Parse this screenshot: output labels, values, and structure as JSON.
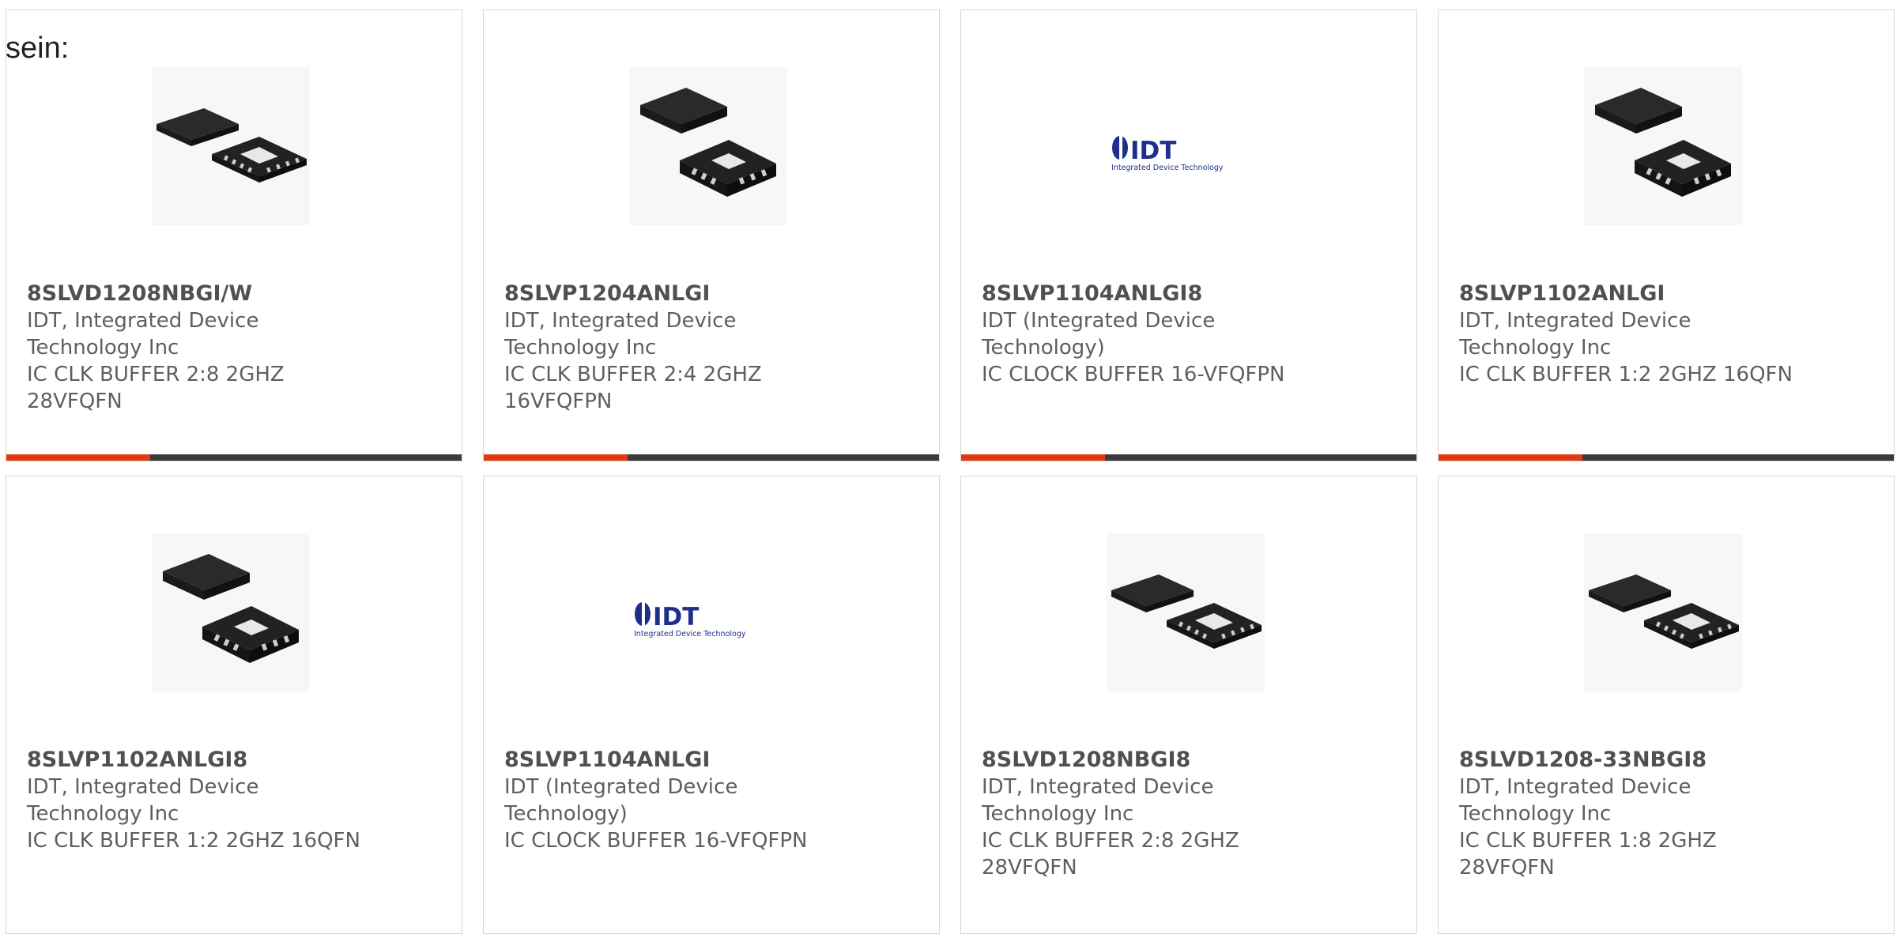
{
  "intro": {
    "text": "sein:"
  },
  "products": [
    {
      "part": "8SLVD1208NBGI/W",
      "manufacturer": "IDT, Integrated Device Technology Inc",
      "description": "IC CLK BUFFER 2:8 2GHZ 28VFQFN",
      "image": "qfn-chip-28-image"
    },
    {
      "part": "8SLVP1204ANLGI",
      "manufacturer": "IDT, Integrated Device Technology Inc",
      "description": "IC CLK BUFFER 2:4 2GHZ 16VFQFPN",
      "image": "qfn-chip-16-image"
    },
    {
      "part": "8SLVP1104ANLGI8",
      "manufacturer": "IDT (Integrated Device Technology)",
      "description": "IC CLOCK BUFFER 16-VFQFPN",
      "image": "idt-logo-image",
      "logo": {
        "mark": "IDT",
        "tagline": "Integrated Device Technology"
      }
    },
    {
      "part": "8SLVP1102ANLGI",
      "manufacturer": "IDT, Integrated Device Technology Inc",
      "description": "IC CLK BUFFER 1:2 2GHZ 16QFN",
      "image": "qfn-chip-16-image"
    },
    {
      "part": "8SLVP1102ANLGI8",
      "manufacturer": "IDT, Integrated Device Technology Inc",
      "description": "IC CLK BUFFER 1:2 2GHZ 16QFN",
      "image": "qfn-chip-16-image"
    },
    {
      "part": "8SLVP1104ANLGI",
      "manufacturer": "IDT (Integrated Device Technology)",
      "description": "IC CLOCK BUFFER 16-VFQFPN",
      "image": "idt-logo-image",
      "logo": {
        "mark": "IDT",
        "tagline": "Integrated Device Technology"
      }
    },
    {
      "part": "8SLVD1208NBGI8",
      "manufacturer": "IDT, Integrated Device Technology Inc",
      "description": "IC CLK BUFFER 2:8 2GHZ 28VFQFN",
      "image": "qfn-chip-28-image"
    },
    {
      "part": "8SLVD1208-33NBGI8",
      "manufacturer": "IDT, Integrated Device Technology Inc",
      "description": "IC CLK BUFFER 1:8 2GHZ 28VFQFN",
      "image": "qfn-chip-28-image"
    }
  ],
  "colors": {
    "accent": "#e03a12",
    "bar": "#3b3b3b",
    "border": "#d6d6d6",
    "text": "#5f5f5f",
    "logo_blue": "#1f2e8a"
  }
}
